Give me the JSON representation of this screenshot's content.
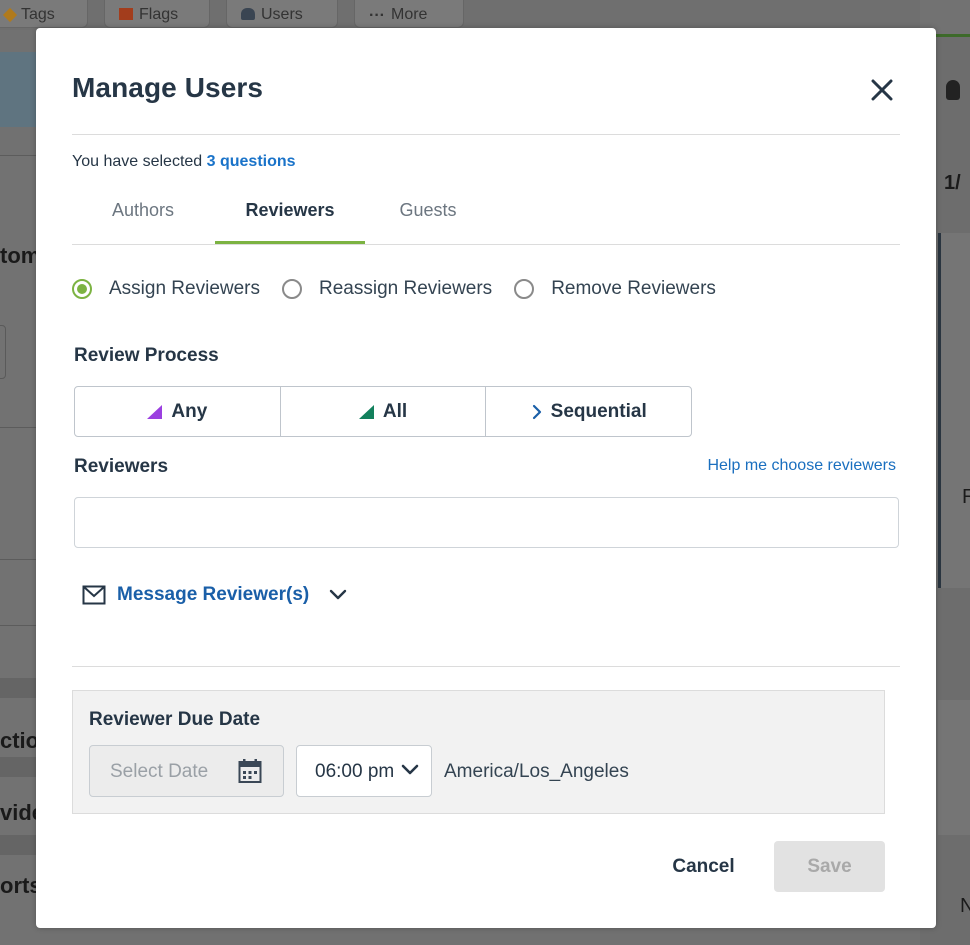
{
  "background": {
    "toolbar": [
      "Tags",
      "Flags",
      "Users",
      "More"
    ],
    "left_fragments": [
      "tom",
      "ction",
      "vide",
      "orts"
    ],
    "right_fragments": [
      "1/",
      "R",
      "N"
    ]
  },
  "modal": {
    "title": "Manage Users",
    "close_icon": "close-icon",
    "selection": {
      "prefix": "You have selected",
      "link": "3 questions"
    },
    "tabs": [
      {
        "label": "Authors",
        "active": false
      },
      {
        "label": "Reviewers",
        "active": true
      },
      {
        "label": "Guests",
        "active": false
      }
    ],
    "mode_options": [
      {
        "label": "Assign Reviewers",
        "checked": true
      },
      {
        "label": "Reassign Reviewers",
        "checked": false
      },
      {
        "label": "Remove Reviewers",
        "checked": false
      }
    ],
    "review_process": {
      "label": "Review Process",
      "options": [
        {
          "label": "Any",
          "icon": "triangle-icon",
          "color": "#9b3fe0"
        },
        {
          "label": "All",
          "icon": "triangle-icon",
          "color": "#12805c"
        },
        {
          "label": "Sequential",
          "icon": "chevron-right-icon",
          "color": "#1a5fa8"
        }
      ]
    },
    "reviewers": {
      "label": "Reviewers",
      "help_link": "Help me choose reviewers",
      "value": ""
    },
    "message": {
      "label": "Message Reviewer(s)",
      "icon": "envelope-icon",
      "toggle_icon": "chevron-down-icon"
    },
    "due_date": {
      "label": "Reviewer Due Date",
      "date_placeholder": "Select Date",
      "time": "06:00 pm",
      "timezone": "America/Los_Angeles"
    },
    "actions": {
      "cancel": "Cancel",
      "save": "Save"
    }
  },
  "colors": {
    "accent_green": "#7cb342",
    "link_blue": "#1a73c9",
    "heading": "#263646"
  }
}
